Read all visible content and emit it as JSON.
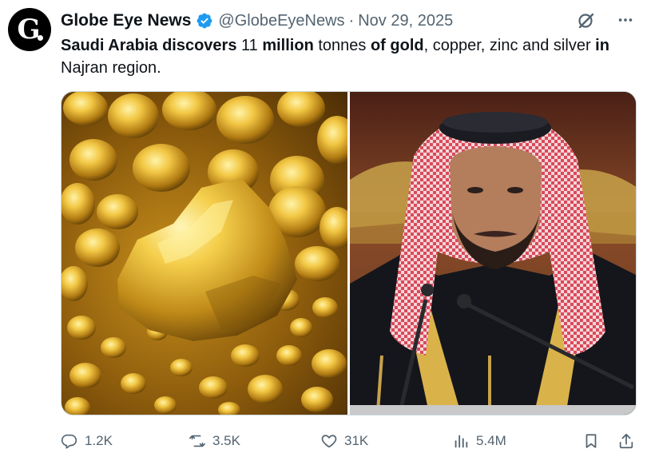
{
  "author": {
    "display_name": "Globe Eye News",
    "handle": "@GlobeEyeNews",
    "separator": "·",
    "date": "Nov 29, 2025",
    "avatar_letter": "G",
    "verified_color": "#1d9bf0"
  },
  "tweet": {
    "segments": [
      {
        "text": "Saudi Arabia discovers",
        "bold": true
      },
      {
        "text": " 11 ",
        "bold": false
      },
      {
        "text": "million",
        "bold": true
      },
      {
        "text": " tonnes ",
        "bold": false
      },
      {
        "text": "of gold",
        "bold": true
      },
      {
        "text": ", copper, zinc and silver ",
        "bold": false
      },
      {
        "text": "in",
        "bold": true
      },
      {
        "text": " Najran region.",
        "bold": false
      }
    ]
  },
  "media": {
    "left_image": "gold-nuggets-photo",
    "right_image": "man-in-red-keffiyeh-at-microphone-photo"
  },
  "actions": {
    "reply_count": "1.2K",
    "repost_count": "3.5K",
    "like_count": "31K",
    "views_count": "5.4M"
  },
  "colors": {
    "text": "#0f1419",
    "secondary": "#536471",
    "accent": "#1d9bf0"
  }
}
